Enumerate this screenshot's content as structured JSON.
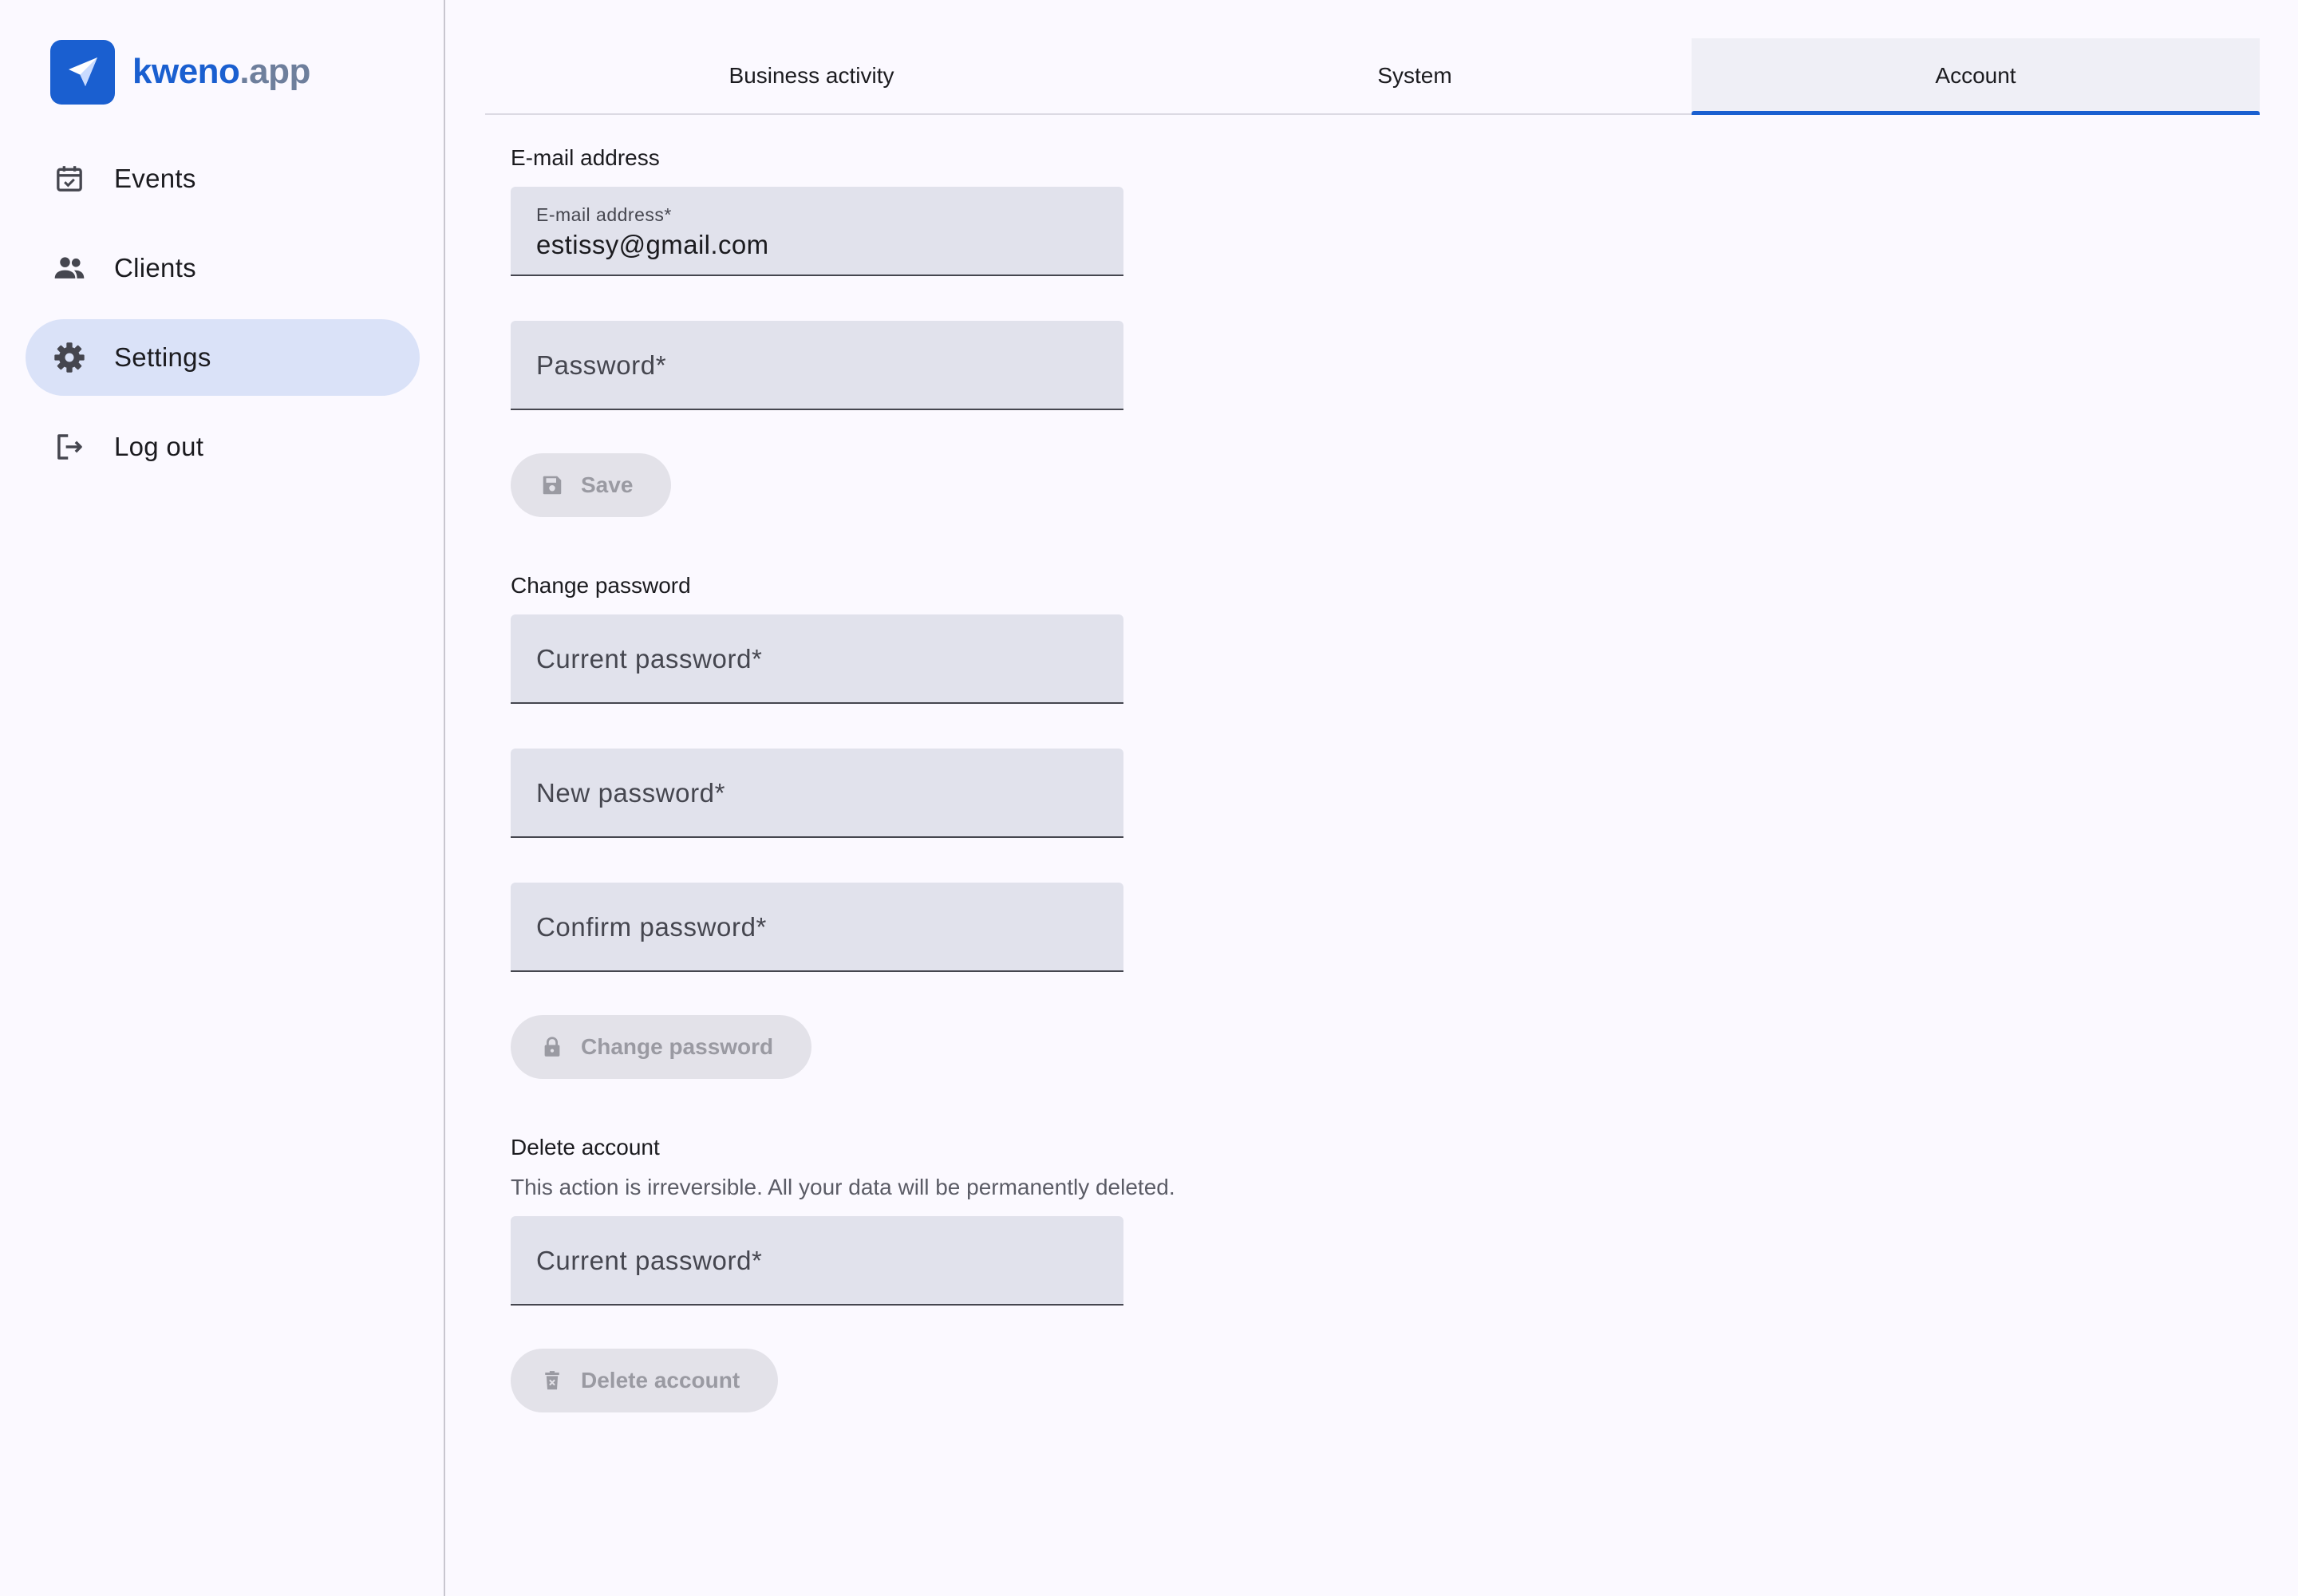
{
  "brand": {
    "name_main": "kweno",
    "name_tld": ".app"
  },
  "sidebar": {
    "items": [
      {
        "label": "Events",
        "icon": "calendar-check-icon"
      },
      {
        "label": "Clients",
        "icon": "people-icon"
      },
      {
        "label": "Settings",
        "icon": "gear-icon",
        "active": true
      },
      {
        "label": "Log out",
        "icon": "logout-icon"
      }
    ]
  },
  "tabs": [
    {
      "label": "Business activity"
    },
    {
      "label": "System"
    },
    {
      "label": "Account",
      "active": true
    }
  ],
  "email_section": {
    "title": "E-mail address",
    "email_label": "E-mail address*",
    "email_value": "estissy@gmail.com",
    "password_placeholder": "Password*",
    "save_label": "Save"
  },
  "password_section": {
    "title": "Change password",
    "current_placeholder": "Current password*",
    "new_placeholder": "New password*",
    "confirm_placeholder": "Confirm password*",
    "button_label": "Change password"
  },
  "delete_section": {
    "title": "Delete account",
    "description": "This action is irreversible. All your data will be permanently deleted.",
    "current_placeholder": "Current password*",
    "button_label": "Delete account"
  },
  "colors": {
    "accent": "#1a5fd0",
    "active_nav": "#dae2f8",
    "field_bg": "#e1e2ec"
  }
}
